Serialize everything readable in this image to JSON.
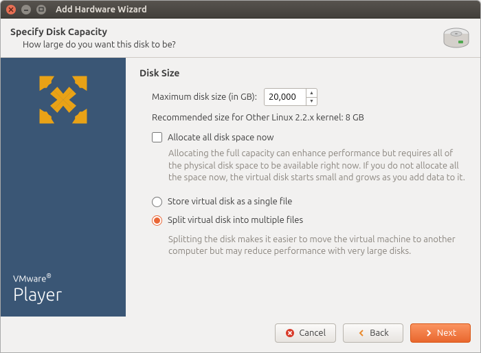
{
  "window": {
    "title": "Add Hardware Wizard"
  },
  "header": {
    "title": "Specify Disk Capacity",
    "subtitle": "How large do you want this disk to be?"
  },
  "branding": {
    "company": "VMware",
    "product": "Player"
  },
  "content": {
    "section_title": "Disk Size",
    "max_size_label": "Maximum disk size (in GB):",
    "max_size_value": "20,000",
    "recommended": "Recommended size for Other Linux 2.2.x kernel: 8 GB",
    "allocate_now": {
      "label": "Allocate all disk space now",
      "checked": false,
      "desc": "Allocating the full capacity can enhance performance but requires all of the physical disk space to be available right now. If you do not allocate all the space now, the virtual disk starts small and grows as you add data to it."
    },
    "storage_mode": {
      "single_label": "Store virtual disk as a single file",
      "split_label": "Split virtual disk into multiple files",
      "selected": "split",
      "split_desc": "Splitting the disk makes it easier to move the virtual machine to another computer but may reduce performance with very large disks."
    }
  },
  "buttons": {
    "cancel": "Cancel",
    "back": "Back",
    "next": "Next"
  }
}
